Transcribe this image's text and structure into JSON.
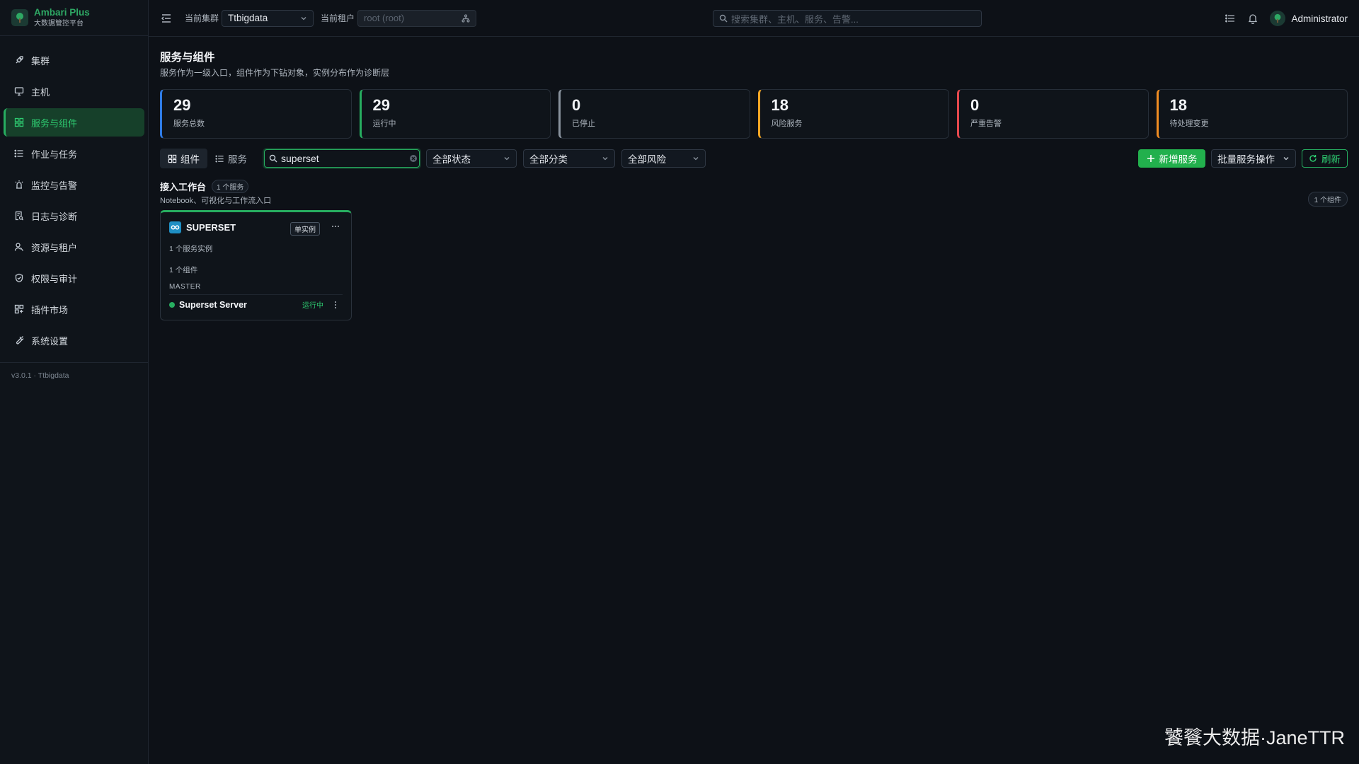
{
  "app": {
    "brand_title": "Ambari Plus",
    "brand_subtitle": "大数据管控平台",
    "version": "v3.0.1 · Ttbigdata"
  },
  "sidebar": {
    "items": [
      {
        "label": "集群",
        "icon": "rocket-icon",
        "active": false
      },
      {
        "label": "主机",
        "icon": "monitor-icon",
        "active": false
      },
      {
        "label": "服务与组件",
        "icon": "grid-icon",
        "active": true
      },
      {
        "label": "作业与任务",
        "icon": "list-icon",
        "active": false
      },
      {
        "label": "监控与告警",
        "icon": "alarm-icon",
        "active": false
      },
      {
        "label": "日志与诊断",
        "icon": "log-search-icon",
        "active": false
      },
      {
        "label": "资源与租户",
        "icon": "users-icon",
        "active": false
      },
      {
        "label": "权限与审计",
        "icon": "shield-icon",
        "active": false
      },
      {
        "label": "插件市场",
        "icon": "plugin-icon",
        "active": false
      },
      {
        "label": "系统设置",
        "icon": "wrench-icon",
        "active": false
      }
    ]
  },
  "header": {
    "cluster_label": "当前集群",
    "cluster_value": "Ttbigdata",
    "tenant_label": "当前租户",
    "tenant_placeholder": "root (root)",
    "search_placeholder": "搜索集群、主机、服务、告警...",
    "user_name": "Administrator"
  },
  "page": {
    "title": "服务与组件",
    "subtitle": "服务作为一级入口，组件作为下钻对象，实例分布作为诊断层"
  },
  "stats": [
    {
      "value": "29",
      "label": "服务总数",
      "color": "#2f7be5"
    },
    {
      "value": "29",
      "label": "运行中",
      "color": "#27ae60"
    },
    {
      "value": "0",
      "label": "已停止",
      "color": "#8a939e"
    },
    {
      "value": "18",
      "label": "风险服务",
      "color": "#f5a623"
    },
    {
      "value": "0",
      "label": "严重告警",
      "color": "#e5484d"
    },
    {
      "value": "18",
      "label": "待处理变更",
      "color": "#f08c22"
    }
  ],
  "toolbar": {
    "view_components": "组件",
    "view_services": "服务",
    "search_value": "superset",
    "filter_status": "全部状态",
    "filter_category": "全部分类",
    "filter_risk": "全部风险",
    "add_service": "新增服务",
    "batch_ops": "批量服务操作",
    "refresh": "刷新"
  },
  "group": {
    "title": "接入工作台",
    "service_count": "1 个服务",
    "description": "Notebook、可视化与工作流入口",
    "component_count": "1 个组件"
  },
  "card": {
    "service_name": "SUPERSET",
    "badge": "单实例",
    "instances": "1 个服务实例",
    "components": "1 个组件",
    "role": "MASTER",
    "component_name": "Superset Server",
    "component_status": "运行中"
  },
  "watermark": "饕餮大数据·JaneTTR"
}
